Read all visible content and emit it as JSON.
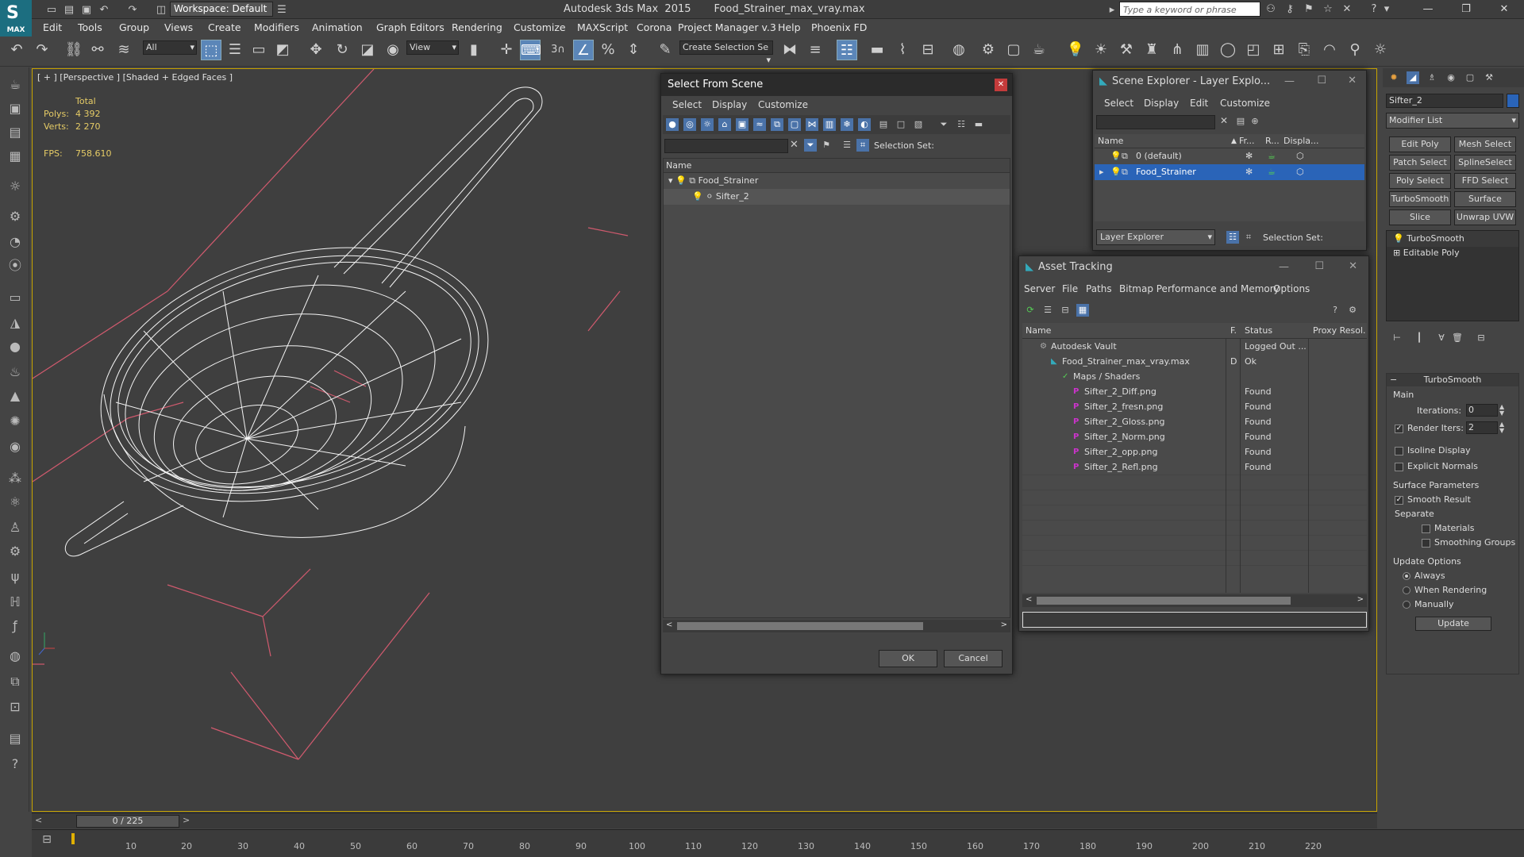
{
  "titlebar": {
    "workspace": "Workspace: Default",
    "title": "Autodesk 3ds Max  2015       Food_Strainer_max_vray.max",
    "search_placeholder": "Type a keyword or phrase",
    "logo": "MAX"
  },
  "menu": [
    "Edit",
    "Tools",
    "Group",
    "Views",
    "Create",
    "Modifiers",
    "Animation",
    "Graph Editors",
    "Rendering",
    "Customize",
    "MAXScript",
    "Corona",
    "Project Manager v.3",
    "Help",
    "Phoenix FD"
  ],
  "toolbar": {
    "filter": "All",
    "refcoord": "View",
    "selection_set": "Create Selection Se",
    "snap_num": "3"
  },
  "viewport": {
    "label": "[ + ] [Perspective ] [Shaded + Edged Faces ]",
    "total": "Total",
    "polys_label": "Polys:",
    "polys": "4 392",
    "verts_label": "Verts:",
    "verts": "2 270",
    "fps_label": "FPS:",
    "fps": "758.610"
  },
  "timeline": {
    "frame": "0 / 225",
    "ticks": [
      "10",
      "20",
      "30",
      "40",
      "50",
      "60",
      "70",
      "80",
      "90",
      "100",
      "110",
      "120",
      "130",
      "140",
      "150",
      "160",
      "170",
      "180",
      "190",
      "200",
      "210",
      "220"
    ]
  },
  "select_from_scene": {
    "title": "Select From Scene",
    "menu": [
      "Select",
      "Display",
      "Customize"
    ],
    "selection_set": "Selection Set:",
    "col_name": "Name",
    "items": [
      {
        "name": "Food_Strainer"
      },
      {
        "name": "Sifter_2"
      }
    ],
    "ok": "OK",
    "cancel": "Cancel"
  },
  "scene_explorer": {
    "title": "Scene Explorer - Layer Explo...",
    "menu": [
      "Select",
      "Display",
      "Edit",
      "Customize"
    ],
    "cols": [
      "Name",
      "Fr...",
      "R...",
      "Displa..."
    ],
    "rows": [
      "0 (default)",
      "Food_Strainer"
    ],
    "footer_combo": "Layer Explorer",
    "selection_set": "Selection Set:"
  },
  "asset_tracking": {
    "title": "Asset Tracking",
    "menu": [
      "Server",
      "File",
      "Paths",
      "Bitmap Performance and Memory",
      "Options"
    ],
    "cols": [
      "Name",
      "F.",
      "Status",
      "Proxy Resol."
    ],
    "rows": [
      {
        "name": "Autodesk Vault",
        "f": "",
        "status": "Logged Out ..."
      },
      {
        "name": "Food_Strainer_max_vray.max",
        "f": "D",
        "status": "Ok"
      },
      {
        "name": "Maps / Shaders",
        "f": "",
        "status": ""
      },
      {
        "name": "Sifter_2_Diff.png",
        "f": "",
        "status": "Found"
      },
      {
        "name": "Sifter_2_fresn.png",
        "f": "",
        "status": "Found"
      },
      {
        "name": "Sifter_2_Gloss.png",
        "f": "",
        "status": "Found"
      },
      {
        "name": "Sifter_2_Norm.png",
        "f": "",
        "status": "Found"
      },
      {
        "name": "Sifter_2_opp.png",
        "f": "",
        "status": "Found"
      },
      {
        "name": "Sifter_2_Refl.png",
        "f": "",
        "status": "Found"
      }
    ]
  },
  "command_panel": {
    "object_name": "Sifter_2",
    "modifier_list": "Modifier List",
    "mod_buttons": [
      "Edit Poly",
      "Mesh Select",
      "Patch Select",
      "SplineSelect",
      "Poly Select",
      "FFD Select",
      "TurboSmooth",
      "Surface Select",
      "Slice",
      "Unwrap UVW"
    ],
    "stack": [
      "TurboSmooth",
      "Editable Poly"
    ],
    "rollout": "TurboSmooth",
    "main": "Main",
    "iterations_label": "Iterations:",
    "iterations": "0",
    "render_iters_label": "Render Iters:",
    "render_iters": "2",
    "isoline": "Isoline Display",
    "explicit": "Explicit Normals",
    "surface_params": "Surface Parameters",
    "smooth_result": "Smooth Result",
    "separate": "Separate",
    "materials": "Materials",
    "smoothing_groups": "Smoothing Groups",
    "update_options": "Update Options",
    "always": "Always",
    "when_rendering": "When Rendering",
    "manually": "Manually",
    "update": "Update"
  },
  "colors": {
    "accent": "#5b86b8",
    "selection": "#2a64b8",
    "viewport_border": "#c8a400"
  }
}
